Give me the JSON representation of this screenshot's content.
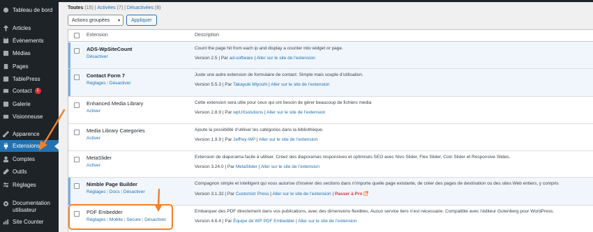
{
  "sidebar": {
    "items": [
      {
        "label": "Tableau de bord",
        "icon": "dashboard-icon"
      },
      {
        "label": "Articles",
        "icon": "pin-icon"
      },
      {
        "label": "Évènements",
        "icon": "calendar-icon"
      },
      {
        "label": "Médias",
        "icon": "media-icon"
      },
      {
        "label": "Pages",
        "icon": "pages-icon"
      },
      {
        "label": "TablePress",
        "icon": "table-icon"
      },
      {
        "label": "Contact",
        "icon": "mail-icon",
        "badge": "1"
      },
      {
        "label": "Galerie",
        "icon": "gallery-icon"
      },
      {
        "label": "Visionneuse",
        "icon": "viewer-icon"
      },
      {
        "label": "Apparence",
        "icon": "brush-icon"
      },
      {
        "label": "Extensions",
        "icon": "plugin-icon",
        "current": true
      },
      {
        "label": "Comptes",
        "icon": "user-icon"
      },
      {
        "label": "Outils",
        "icon": "wrench-icon"
      },
      {
        "label": "Réglages",
        "icon": "settings-icon"
      },
      {
        "label": "Documentation utilisateur",
        "icon": "gear-icon"
      },
      {
        "label": "Site Counter",
        "icon": "counter-icon"
      }
    ]
  },
  "filters": {
    "all": "Toutes",
    "all_count": "(15)",
    "active": "Activées",
    "active_count": "(7)",
    "inactive": "Désactivées",
    "inactive_count": "(8)"
  },
  "bulk": {
    "selected": "Actions groupées",
    "apply": "Appliquer"
  },
  "table": {
    "col_extension": "Extension",
    "col_description": "Description"
  },
  "plugins": [
    {
      "name": "ADS-WpSiteCount",
      "active": true,
      "actions": [
        "Désactiver"
      ],
      "description": "Count the page hit from each ip and display a counter into widget or page.",
      "version": "Version 2.5",
      "by": "Par",
      "author": "ad-software",
      "site": "Aller sur le site de l’extension"
    },
    {
      "name": "Contact Form 7",
      "active": true,
      "actions": [
        "Réglages",
        "Désactiver"
      ],
      "description": "Juste une autre extension de formulaire de contact. Simple mais souple d’utilisation.",
      "version": "Version 5.5.3",
      "by": "Par",
      "author": "Takayuki Miyoshi",
      "site": "Aller sur le site de l’extension"
    },
    {
      "name": "Enhanced Media Library",
      "active": false,
      "actions": [
        "Activer"
      ],
      "description": "Cette extension sera utile pour ceux qui ont besoin de gérer beaucoup de fichiers média",
      "version": "Version 2.8.9",
      "by": "Par",
      "author": "wpUXsolutions",
      "site": "Aller sur le site de l’extension"
    },
    {
      "name": "Media Library Categories",
      "active": false,
      "actions": [
        "Activer"
      ],
      "description": "Ajoute la possibilité d’utiliser les catégories dans la bibliothèque.",
      "version": "Version 1.9.9",
      "by": "Par",
      "author": "Jeffrey-WP",
      "site": "Aller sur le site de l’extension"
    },
    {
      "name": "MetaSlider",
      "active": false,
      "actions": [
        "Activer"
      ],
      "description": "Extension de diaporama facile à utiliser. Créez des diaporamas responsives et optimisés SEO avec Nivo Slider, Flex Slider, Coin Slider et Responsive Slides.",
      "version": "Version 3.24.0",
      "by": "Par",
      "author": "MetaSlider",
      "site": "Aller sur le site de l’extension"
    },
    {
      "name": "Nimble Page Builder",
      "active": true,
      "actions": [
        "Réglages",
        "Docs",
        "Désactiver"
      ],
      "description": "Compagnon simple et intelligent qui vous autorise d’insérer des sections dans n’importe quelle page existante, de créer des pages de destination ou des sites Web entiers, y compris",
      "version": "Version 3.1.32",
      "by": "Par",
      "author": "Customizr Press",
      "site": "Aller sur le site de l’extension",
      "pro": "Passer à Pro"
    },
    {
      "name": "PDF Embedder",
      "active": false,
      "actions": [
        "Réglages",
        "Mobile",
        "Secure",
        "Désactiver"
      ],
      "description": "Embarquer des PDF directement dans vos publications, avec des dimensions flexibles. Aucun service tiers n’est nécessaire. Compatible avec l’éditeur Gutenberg pour WordPress.",
      "version": "Version 4.6.4",
      "by": "Par",
      "author": "Équipe de WP PDF Embedder",
      "site": "Aller sur le site de l’extension"
    }
  ],
  "colors": {
    "sidebar_bg": "#1d2327",
    "accent": "#2271b1",
    "highlight": "#f58025"
  }
}
